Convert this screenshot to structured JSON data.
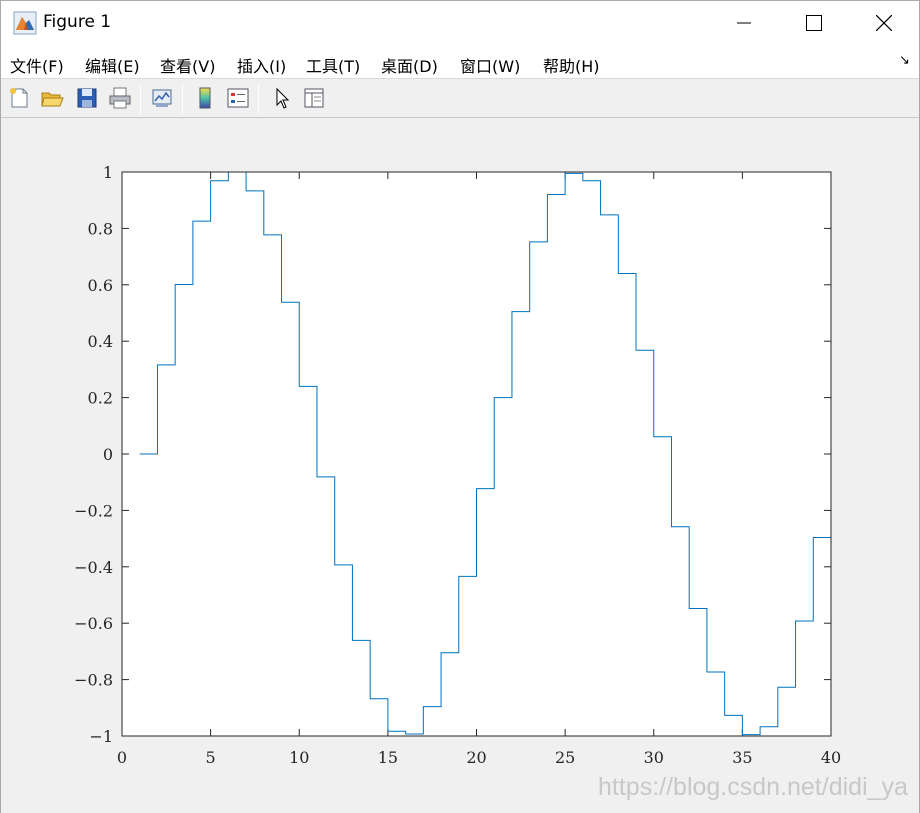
{
  "window": {
    "title": "Figure 1",
    "icon": "matlab-figure-icon",
    "controls": [
      "minimize-icon",
      "maximize-icon",
      "close-icon"
    ]
  },
  "menu": {
    "items": [
      "文件(F)",
      "编辑(E)",
      "查看(V)",
      "插入(I)",
      "工具(T)",
      "桌面(D)",
      "窗口(W)",
      "帮助(H)"
    ],
    "dock_glyph": "↘"
  },
  "toolbar": {
    "icons": [
      "new-figure-icon",
      "open-file-icon",
      "save-icon",
      "print-icon",
      "link-plot-icon",
      "insert-colorbar-icon",
      "insert-legend-icon",
      "edit-plot-arrow-icon",
      "property-inspector-icon"
    ]
  },
  "watermark": "https://blog.csdn.net/didi_ya",
  "colors": {
    "line": "#0072bd",
    "axes_bg": "#ffffff",
    "figure_bg": "#f0f0f0"
  },
  "chart_data": {
    "type": "line",
    "style": "stairs",
    "title": "",
    "xlabel": "",
    "ylabel": "",
    "xlim": [
      0,
      40
    ],
    "ylim": [
      -1,
      1
    ],
    "grid": false,
    "box": true,
    "xticks": [
      0,
      5,
      10,
      15,
      20,
      25,
      30,
      35,
      40
    ],
    "xtick_labels": [
      "0",
      "5",
      "10",
      "15",
      "20",
      "25",
      "30",
      "35",
      "40"
    ],
    "yticks": [
      -1,
      -0.8,
      -0.6,
      -0.4,
      -0.2,
      0,
      0.2,
      0.4,
      0.6,
      0.8,
      1
    ],
    "ytick_labels": [
      "−1",
      "−0.8",
      "−0.6",
      "−0.4",
      "−0.2",
      "0",
      "0.2",
      "0.4",
      "0.6",
      "0.8",
      "1"
    ],
    "series": [
      {
        "x": [
          1,
          2,
          3,
          4,
          5,
          6,
          7,
          8,
          9,
          10,
          11,
          12,
          13,
          14,
          15,
          16,
          17,
          18,
          19,
          20,
          21,
          22,
          23,
          24,
          25,
          26,
          27,
          28,
          29,
          30,
          31,
          32,
          33,
          34,
          35,
          36,
          37,
          38,
          39,
          40
        ],
        "y": [
          0.0,
          0.316,
          0.601,
          0.826,
          0.969,
          1.0,
          0.933,
          0.777,
          0.538,
          0.24,
          -0.081,
          -0.393,
          -0.661,
          -0.868,
          -0.983,
          -0.993,
          -0.896,
          -0.705,
          -0.434,
          -0.123,
          0.2,
          0.505,
          0.752,
          0.92,
          0.995,
          0.969,
          0.848,
          0.64,
          0.368,
          0.061,
          -0.258,
          -0.548,
          -0.773,
          -0.927,
          -0.995,
          -0.967,
          -0.827,
          -0.592,
          -0.296,
          0.0
        ]
      }
    ]
  }
}
